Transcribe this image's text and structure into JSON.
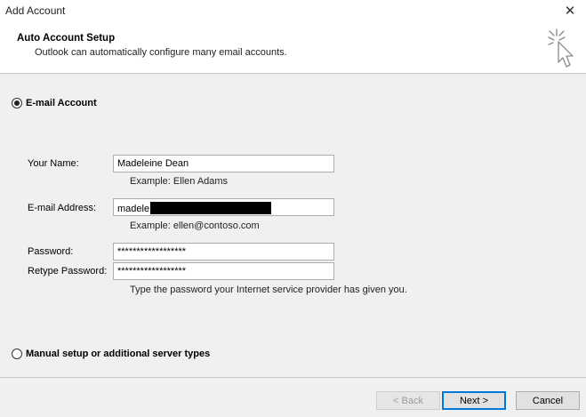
{
  "window": {
    "title": "Add Account",
    "close_glyph": "✕"
  },
  "header": {
    "title": "Auto Account Setup",
    "subtitle": "Outlook can automatically configure many email accounts.",
    "icon": "cursor-sparkle-icon"
  },
  "options": {
    "email_account_label": "E-mail Account",
    "email_account_selected": true,
    "manual_setup_label": "Manual setup or additional server types",
    "manual_setup_selected": false
  },
  "form": {
    "name_label": "Your Name:",
    "name_value": "Madeleine Dean",
    "name_example": "Example: Ellen Adams",
    "email_label": "E-mail Address:",
    "email_value_visible": "madele",
    "email_example": "Example: ellen@contoso.com",
    "password_label": "Password:",
    "password_value": "******************",
    "retype_label": "Retype Password:",
    "retype_value": "******************",
    "password_hint": "Type the password your Internet service provider has given you."
  },
  "buttons": {
    "back": "< Back",
    "next": "Next >",
    "cancel": "Cancel"
  },
  "colors": {
    "focus_border": "#0078d7",
    "dialog_bg": "#f0f0f0"
  }
}
